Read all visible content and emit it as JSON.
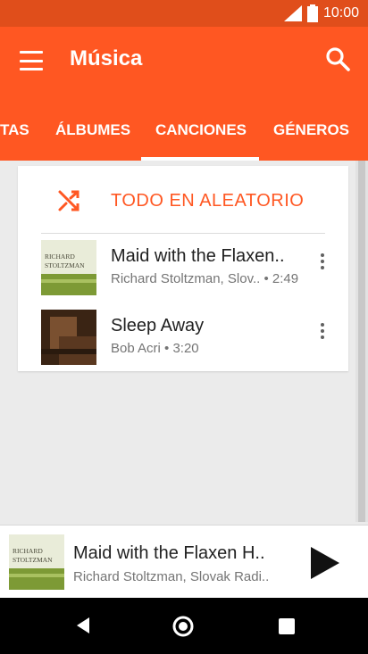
{
  "status_bar": {
    "time": "10:00",
    "icons": [
      "signal-icon",
      "battery-icon"
    ]
  },
  "app_bar": {
    "title": "Música",
    "icons": [
      "menu-icon",
      "search-icon"
    ]
  },
  "tabs": [
    {
      "label": "TAS"
    },
    {
      "label": "ÁLBUMES"
    },
    {
      "label": "CANCIONES",
      "selected": true
    },
    {
      "label": "GÉNEROS"
    }
  ],
  "shuffle": {
    "label": "TODO EN ALEATORIO",
    "icon": "shuffle-icon"
  },
  "songs": [
    {
      "title": "Maid with the Flaxen..",
      "subtitle": "Richard Stoltzman, Slov..  • 2:49",
      "art_text": [
        "RICHARD",
        "STOLTZMAN"
      ]
    },
    {
      "title": "Sleep Away",
      "subtitle": "Bob Acri • 3:20"
    }
  ],
  "now_playing": {
    "title": "Maid with the Flaxen H..",
    "subtitle": "Richard Stoltzman, Slovak Radi..",
    "art_text": [
      "RICHARD",
      "STOLTZMAN"
    ],
    "icon": "play-icon"
  },
  "colors": {
    "primary": "#ff5722",
    "status_bar": "#e04e1b",
    "background": "#ebebeb"
  }
}
